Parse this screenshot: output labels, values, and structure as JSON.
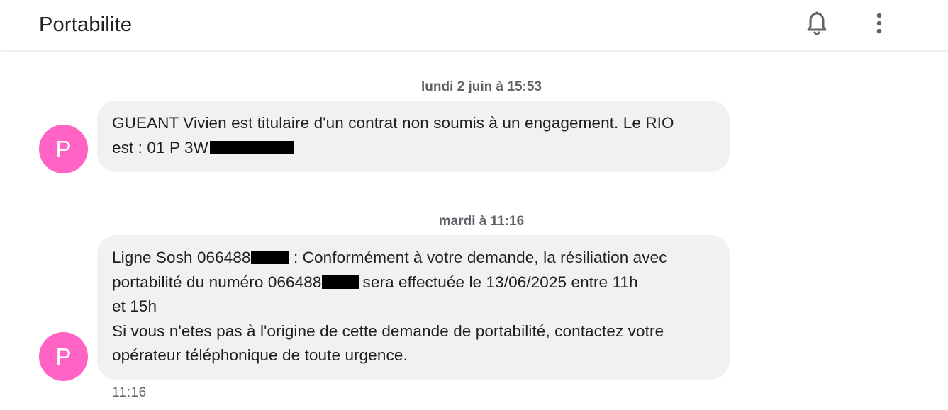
{
  "header": {
    "title": "Portabilite",
    "bell_icon": "bell-icon",
    "menu_icon": "more-vert-icon"
  },
  "colors": {
    "avatar": "#ff63c3",
    "bubble": "#f1f1f1",
    "redaction": "#000000"
  },
  "messages": [
    {
      "date_header": "lundi 2 juin à 15:53",
      "avatar_letter": "P",
      "line1": "GUEANT Vivien est titulaire d'un contrat non soumis à un engagement. Le RIO",
      "line2_prefix": "est : 01 P 3W"
    },
    {
      "date_header": "mardi à 11:16",
      "avatar_letter": "P",
      "l1_prefix": "Ligne Sosh 066488",
      "l1_suffix": " : Conformément à votre demande, la résiliation avec",
      "l2_prefix": "portabilité du numéro  066488",
      "l2_suffix": "sera effectuée le 13/06/2025 entre 11h",
      "l3": "et 15h",
      "l4": "Si vous n'etes pas à l'origine de cette demande de portabilité, contactez votre",
      "l5": "opérateur téléphonique de toute urgence.",
      "time": "11:16"
    }
  ]
}
